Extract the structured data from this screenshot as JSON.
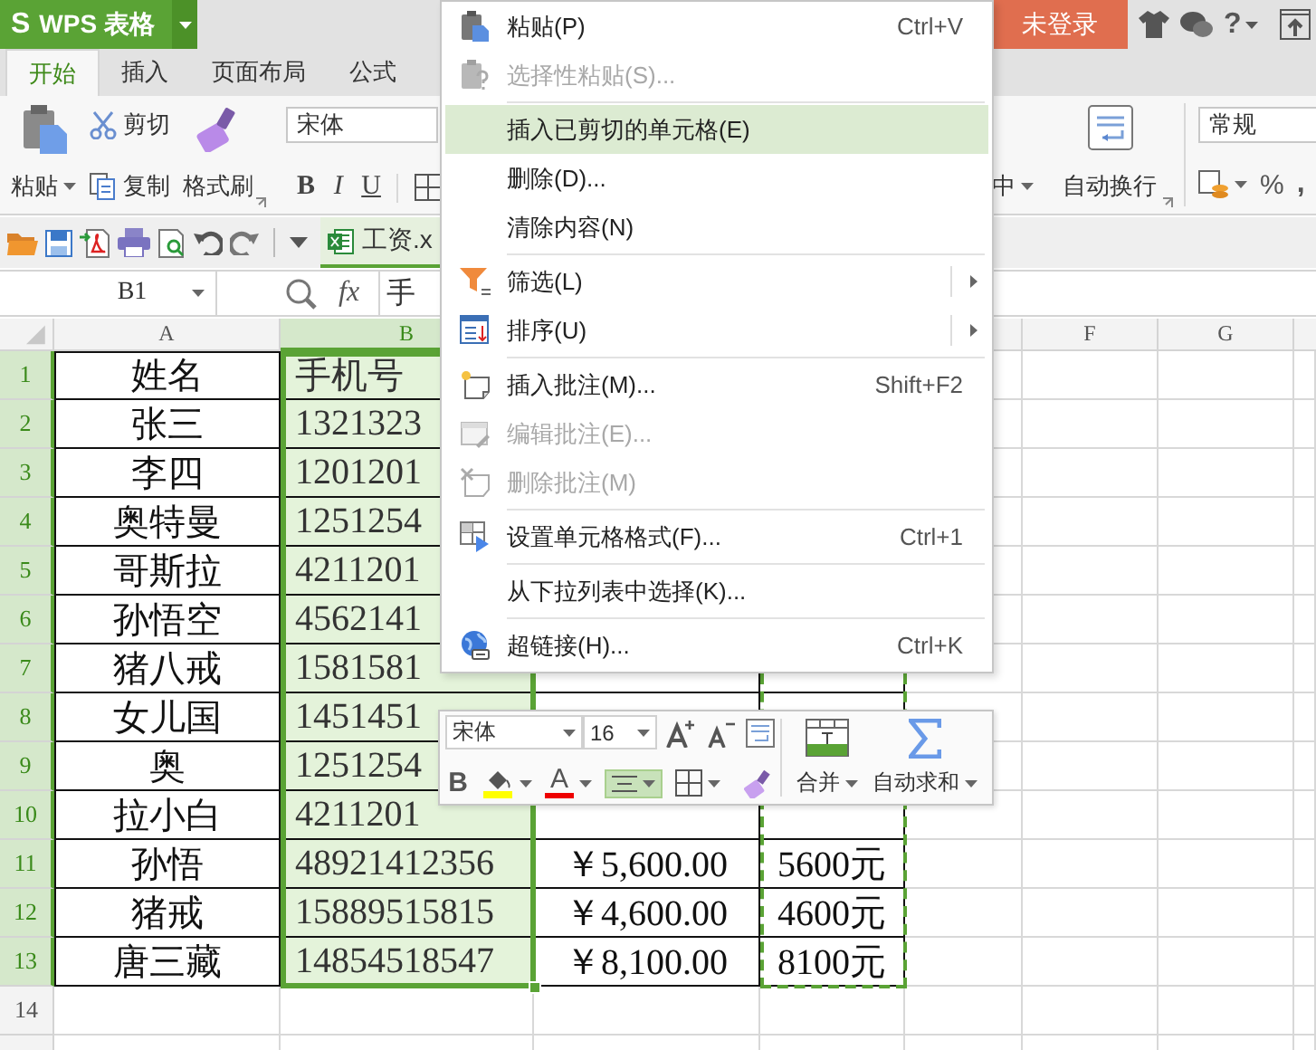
{
  "app": {
    "logo_mark": "S",
    "name": "WPS 表格",
    "login": "未登录",
    "help": "?"
  },
  "tabs": [
    {
      "label": "开始",
      "selected": true
    },
    {
      "label": "插入",
      "selected": false
    },
    {
      "label": "页面布局",
      "selected": false
    },
    {
      "label": "公式",
      "selected": false
    }
  ],
  "ribbon": {
    "paste": "粘贴",
    "cut": "剪切",
    "copy": "复制",
    "format_painter": "格式刷",
    "font": "宋体",
    "bold": "B",
    "italic": "I",
    "underline": "U",
    "merge_center": "中",
    "wrap_text": "自动换行",
    "number_format": "常规",
    "percent": "%",
    "thousands": ","
  },
  "quick_access": {
    "document_tab": "工资.x"
  },
  "formula_bar": {
    "cell_ref": "B1",
    "fx": "fx",
    "content": "手"
  },
  "sheet": {
    "columns": [
      {
        "label": "A",
        "selected": false,
        "copied": false
      },
      {
        "label": "B",
        "selected": true,
        "copied": false
      },
      {
        "selected": false,
        "copied": false
      },
      {
        "selected": false,
        "copied": true
      },
      {
        "selected": false,
        "copied": false
      },
      {
        "label": "F",
        "selected": false,
        "copied": false
      },
      {
        "label": "G",
        "selected": false,
        "copied": false
      }
    ],
    "rows": [
      {
        "number": "1",
        "selected": true,
        "cells": {
          "a": "姓名",
          "b": "手机号"
        }
      },
      {
        "number": "2",
        "selected": true,
        "cells": {
          "a": "张三",
          "b": "1321323"
        }
      },
      {
        "number": "3",
        "selected": true,
        "cells": {
          "a": "李四",
          "b": "1201201"
        }
      },
      {
        "number": "4",
        "selected": true,
        "cells": {
          "a": "奥特曼",
          "b": "1251254"
        }
      },
      {
        "number": "5",
        "selected": true,
        "cells": {
          "a": "哥斯拉",
          "b": "4211201"
        }
      },
      {
        "number": "6",
        "selected": true,
        "cells": {
          "a": "孙悟空",
          "b": "4562141"
        }
      },
      {
        "number": "7",
        "selected": true,
        "cells": {
          "a": "猪八戒",
          "b": "1581581"
        }
      },
      {
        "number": "8",
        "selected": true,
        "cells": {
          "a": "女儿国",
          "b": "1451451"
        }
      },
      {
        "number": "9",
        "selected": true,
        "cells": {
          "a": "奥",
          "b": "1251254"
        }
      },
      {
        "number": "10",
        "selected": true,
        "cells": {
          "a": "拉小白",
          "b": "4211201"
        }
      },
      {
        "number": "11",
        "selected": true,
        "cells": {
          "a": "孙悟",
          "b": "48921412356",
          "c": "￥5,600.00",
          "d": "5600元"
        }
      },
      {
        "number": "12",
        "selected": true,
        "cells": {
          "a": "猪戒",
          "b": "15889515815",
          "c": "￥4,600.00",
          "d": "4600元"
        }
      },
      {
        "number": "13",
        "selected": true,
        "cells": {
          "a": "唐三藏",
          "b": "14854518547",
          "c": "￥8,100.00",
          "d": "8100元"
        }
      },
      {
        "number": "14",
        "selected": false,
        "cells": {}
      },
      {
        "selected": false,
        "cells": {}
      }
    ]
  },
  "context_menu": {
    "items": [
      {
        "kind": "item",
        "label": "粘贴(P)",
        "shortcut": "Ctrl+V",
        "disabled": false,
        "highlighted": false,
        "submenu": false
      },
      {
        "kind": "item",
        "label": "选择性粘贴(S)...",
        "disabled": true,
        "highlighted": false,
        "submenu": false
      },
      {
        "kind": "separator"
      },
      {
        "kind": "item",
        "label": "插入已剪切的单元格(E)",
        "disabled": false,
        "highlighted": true,
        "submenu": false
      },
      {
        "kind": "item",
        "label": "删除(D)...",
        "disabled": false,
        "highlighted": false,
        "submenu": false
      },
      {
        "kind": "item",
        "label": "清除内容(N)",
        "disabled": false,
        "highlighted": false,
        "submenu": false
      },
      {
        "kind": "separator"
      },
      {
        "kind": "item",
        "label": "筛选(L)",
        "disabled": false,
        "highlighted": false,
        "submenu": true
      },
      {
        "kind": "item",
        "label": "排序(U)",
        "disabled": false,
        "highlighted": false,
        "submenu": true
      },
      {
        "kind": "separator"
      },
      {
        "kind": "item",
        "label": "插入批注(M)...",
        "shortcut": "Shift+F2",
        "disabled": false,
        "highlighted": false,
        "submenu": false
      },
      {
        "kind": "item",
        "label": "编辑批注(E)...",
        "disabled": true,
        "highlighted": false,
        "submenu": false
      },
      {
        "kind": "item",
        "label": "删除批注(M)",
        "disabled": true,
        "highlighted": false,
        "submenu": false
      },
      {
        "kind": "separator"
      },
      {
        "kind": "item",
        "label": "设置单元格格式(F)...",
        "shortcut": "Ctrl+1",
        "disabled": false,
        "highlighted": false,
        "submenu": false
      },
      {
        "kind": "separator"
      },
      {
        "kind": "item",
        "label": "从下拉列表中选择(K)...",
        "disabled": false,
        "highlighted": false,
        "submenu": false
      },
      {
        "kind": "separator"
      },
      {
        "kind": "item",
        "label": "超链接(H)...",
        "shortcut": "Ctrl+K",
        "disabled": false,
        "highlighted": false,
        "submenu": false
      }
    ]
  },
  "mini_toolbar": {
    "font": "宋体",
    "size": "16",
    "bold": "B",
    "font_color": "A",
    "center_align_active": true,
    "merge": "合并",
    "autosum": "自动求和"
  }
}
